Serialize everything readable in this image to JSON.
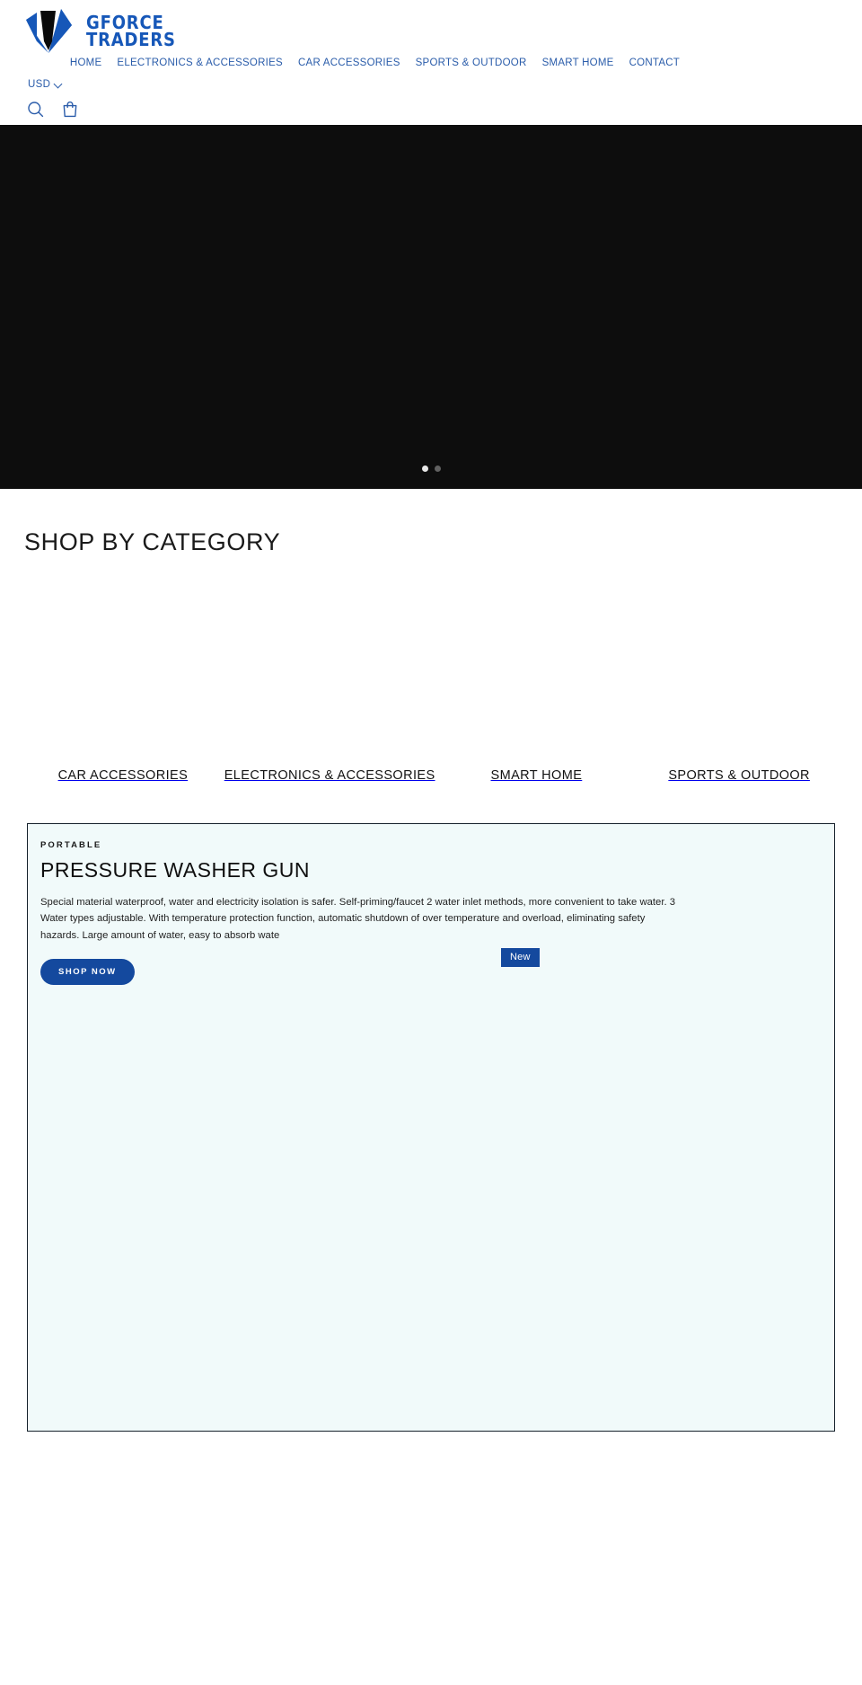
{
  "header": {
    "brand": {
      "line1": "GFORCE",
      "line2": "TRADERS",
      "logo_icon": "diamond-gem-logo-icon",
      "color": "#1657b8"
    },
    "nav": [
      {
        "label": "HOME"
      },
      {
        "label": "ELECTRONICS & ACCESSORIES"
      },
      {
        "label": "CAR ACCESSORIES"
      },
      {
        "label": "SPORTS & OUTDOOR"
      },
      {
        "label": "SMART HOME"
      },
      {
        "label": "CONTACT"
      }
    ],
    "currency": {
      "value": "USD",
      "chevron_icon": "chevron-down-icon"
    },
    "utilities": [
      {
        "icon": "search-icon"
      },
      {
        "icon": "shopping-bag-icon"
      }
    ]
  },
  "hero": {
    "background_color": "#0d0d0d",
    "slides": [
      {
        "index": 1,
        "active": true
      },
      {
        "index": 2,
        "active": false
      }
    ]
  },
  "categories": {
    "title": "SHOP BY CATEGORY",
    "items": [
      {
        "label": "CAR ACCESSORIES"
      },
      {
        "label": "ELECTRONICS & ACCESSORIES"
      },
      {
        "label": "SMART HOME"
      },
      {
        "label": "SPORTS & OUTDOOR"
      }
    ]
  },
  "promo": {
    "eyebrow": "PORTABLE",
    "title": "PRESSURE WASHER GUN",
    "description": "Special material waterproof, water and electricity isolation is safer. Self-priming/faucet 2 water inlet methods, more convenient to take water. 3 Water types adjustable. With temperature protection function, automatic shutdown of over temperature and overload, eliminating safety hazards. Large amount of water, easy to absorb wate",
    "cta_label": "SHOP NOW",
    "badge_label": "New",
    "accent_color": "#14499e",
    "card_background": "#f1fafa"
  }
}
